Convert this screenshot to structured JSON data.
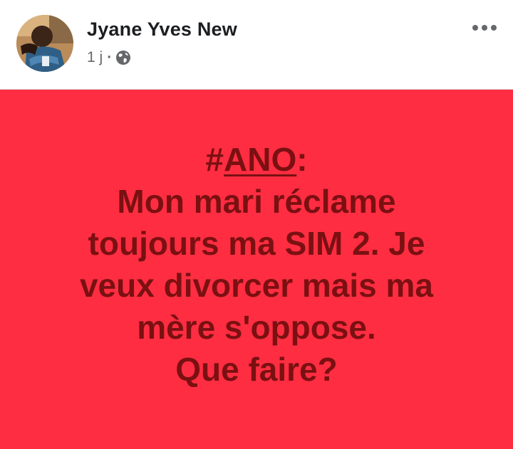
{
  "header": {
    "author_name": "Jyane Yves New",
    "timestamp": "1 j",
    "separator": "·",
    "audience_icon": "globe-icon",
    "more_icon": "more-horizontal-icon"
  },
  "post": {
    "background_color": "#ff2d41",
    "text_color": "#7a1012",
    "hashtag_symbol": "#",
    "hashtag_word": "ANO",
    "hashtag_suffix": ":",
    "lines": [
      "Mon mari réclame",
      "toujours ma SIM 2. Je",
      "veux divorcer mais ma",
      "mère s'oppose.",
      "Que faire?"
    ]
  }
}
